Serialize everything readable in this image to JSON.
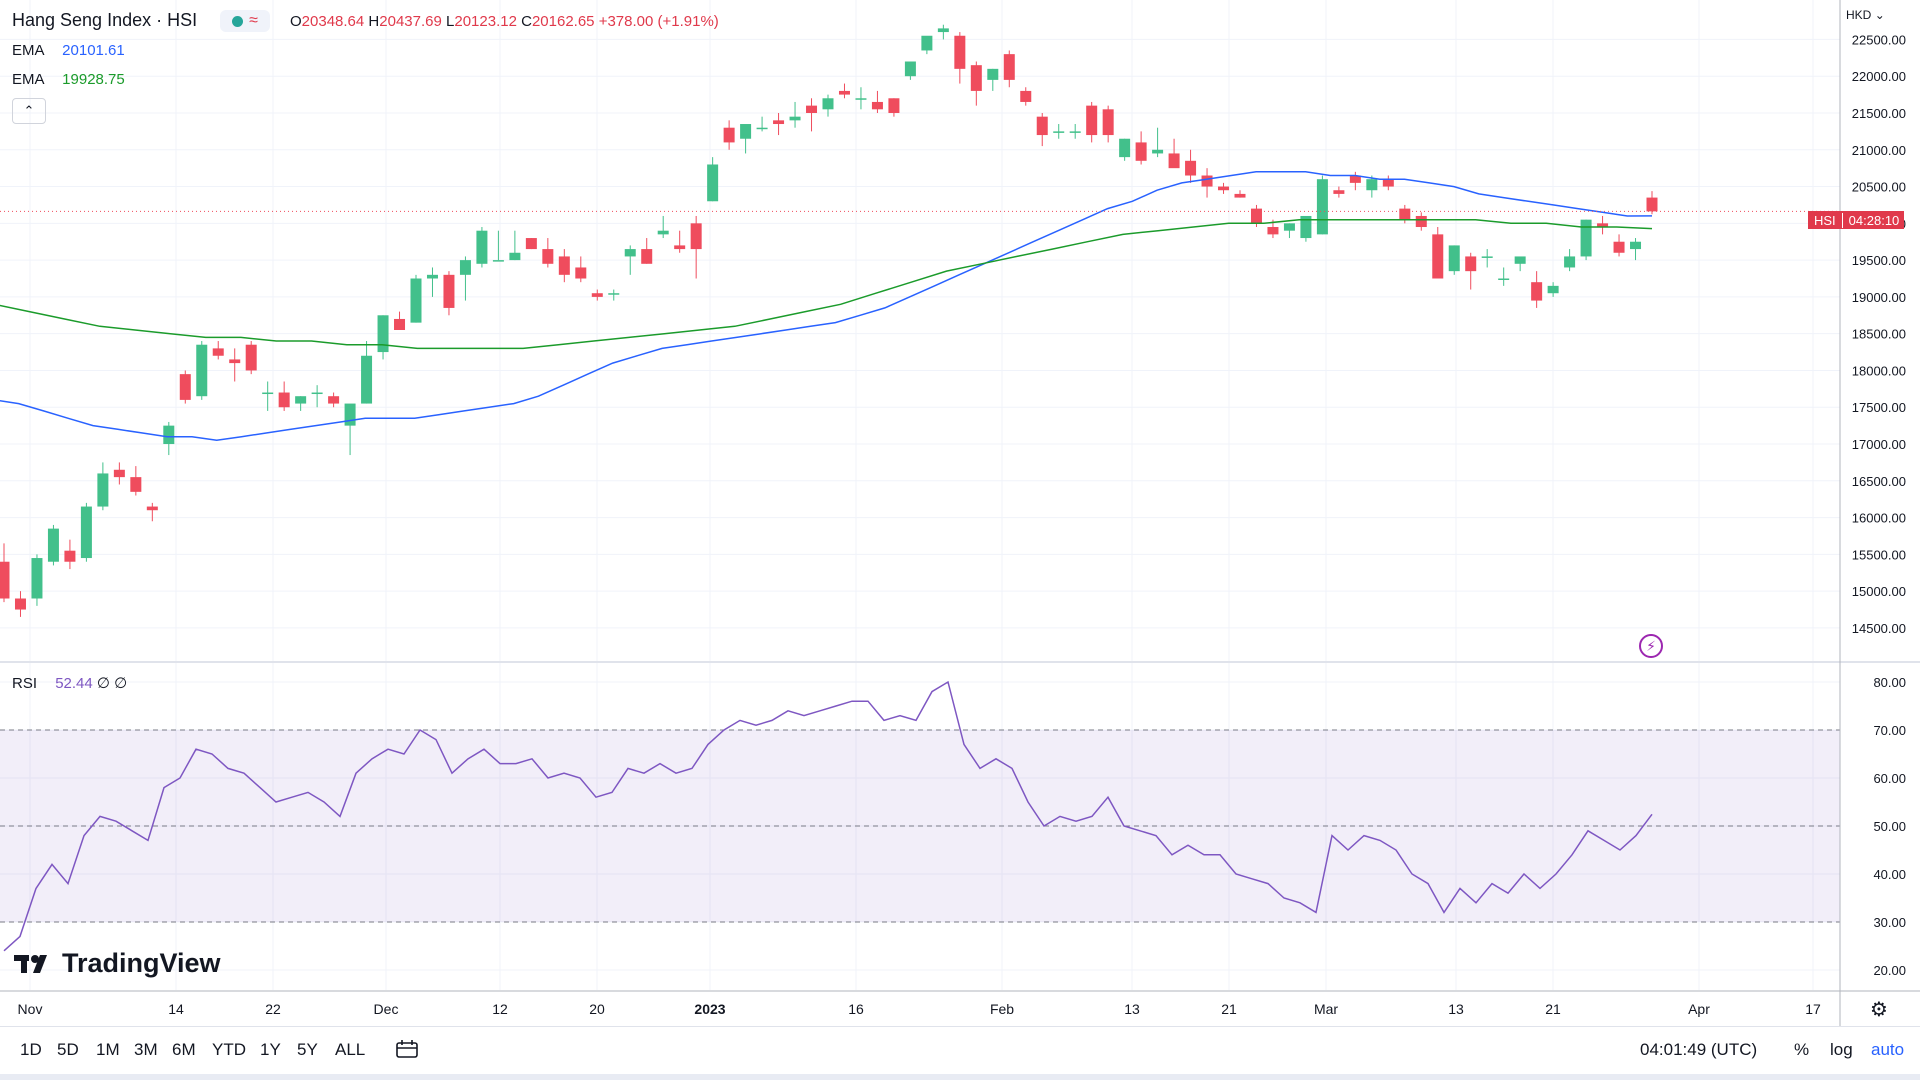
{
  "header": {
    "title": "Hang Seng Index · HSI",
    "ohlc": {
      "o_label": "O",
      "o": "20348.64",
      "h_label": "H",
      "h": "20437.69",
      "l_label": "L",
      "l": "20123.12",
      "c_label": "C",
      "c": "20162.65",
      "change": "+378.00 (+1.91%)"
    }
  },
  "indicators": {
    "ema1": {
      "label": "EMA",
      "value": "20101.61",
      "color": "#2962ff"
    },
    "ema2": {
      "label": "EMA",
      "value": "19928.75",
      "color": "#1b9b2b"
    },
    "rsi": {
      "label": "RSI",
      "value": "52.44",
      "extra": "∅ ∅",
      "color": "#7e57c2"
    }
  },
  "brand": {
    "name": "TradingView"
  },
  "price_axis": {
    "currency": "HKD",
    "ticks": [
      "22500.00",
      "22000.00",
      "21500.00",
      "21000.00",
      "20500.00",
      "20000.00",
      "19500.00",
      "19000.00",
      "18500.00",
      "18000.00",
      "17500.00",
      "17000.00",
      "16500.00",
      "16000.00",
      "15500.00",
      "15000.00",
      "14500.00"
    ],
    "last_tag": {
      "symbol": "HSI",
      "countdown": "04:28:10"
    }
  },
  "rsi_axis": {
    "ticks": [
      "80.00",
      "70.00",
      "60.00",
      "50.00",
      "40.00",
      "30.00",
      "20.00"
    ]
  },
  "time_axis": {
    "labels": [
      "Nov",
      "14",
      "22",
      "Dec",
      "12",
      "20",
      "2023",
      "16",
      "Feb",
      "13",
      "21",
      "Mar",
      "13",
      "21",
      "Apr",
      "17"
    ]
  },
  "toolbar": {
    "ranges": [
      "1D",
      "5D",
      "1M",
      "3M",
      "6M",
      "YTD",
      "1Y",
      "5Y",
      "ALL"
    ],
    "clock": "04:01:49 (UTC)",
    "percent": "%",
    "log": "log",
    "auto": "auto"
  },
  "colors": {
    "up": "#26a69a",
    "down": "#e0394b",
    "up_candle": "#42c08b",
    "down_candle": "#ef4c5d"
  },
  "chart_data": [
    {
      "type": "candlestick",
      "title": "Hang Seng Index · HSI",
      "ylim": [
        14200,
        22900
      ],
      "x_labels": [
        "Nov",
        "14",
        "22",
        "Dec",
        "12",
        "20",
        "2023",
        "16",
        "Feb",
        "13",
        "21",
        "Mar",
        "13",
        "21",
        "Apr",
        "17"
      ],
      "candles": [
        [
          15400,
          15650,
          14850,
          14900
        ],
        [
          14900,
          15000,
          14650,
          14750
        ],
        [
          14900,
          15500,
          14800,
          15450
        ],
        [
          15400,
          15900,
          15350,
          15850
        ],
        [
          15550,
          15700,
          15300,
          15400
        ],
        [
          15450,
          16200,
          15400,
          16150
        ],
        [
          16150,
          16750,
          16100,
          16600
        ],
        [
          16650,
          16750,
          16450,
          16550
        ],
        [
          16550,
          16700,
          16300,
          16350
        ],
        [
          16150,
          16200,
          15950,
          16100
        ],
        [
          17000,
          17300,
          16850,
          17250
        ],
        [
          17950,
          18000,
          17550,
          17600
        ],
        [
          17650,
          18400,
          17600,
          18350
        ],
        [
          18300,
          18400,
          18150,
          18200
        ],
        [
          18150,
          18300,
          17850,
          18100
        ],
        [
          18350,
          18400,
          17950,
          18000
        ],
        [
          17700,
          17850,
          17450,
          17700
        ],
        [
          17700,
          17850,
          17450,
          17500
        ],
        [
          17550,
          17650,
          17450,
          17650
        ],
        [
          17700,
          17800,
          17500,
          17700
        ],
        [
          17650,
          17700,
          17500,
          17550
        ],
        [
          17250,
          17350,
          16850,
          17550
        ],
        [
          17550,
          18400,
          17550,
          18200
        ],
        [
          18250,
          18750,
          18150,
          18750
        ],
        [
          18700,
          18800,
          18600,
          18550
        ],
        [
          18650,
          19300,
          18650,
          19250
        ],
        [
          19250,
          19400,
          19000,
          19300
        ],
        [
          19300,
          19350,
          18750,
          18850
        ],
        [
          19300,
          19550,
          18950,
          19500
        ],
        [
          19450,
          19950,
          19400,
          19900
        ],
        [
          19500,
          19900,
          19500,
          19500
        ],
        [
          19500,
          19900,
          19500,
          19600
        ],
        [
          19800,
          19800,
          19650,
          19650
        ],
        [
          19650,
          19800,
          19400,
          19450
        ],
        [
          19550,
          19650,
          19200,
          19300
        ],
        [
          19400,
          19550,
          19200,
          19250
        ],
        [
          19050,
          19100,
          18950,
          19000
        ],
        [
          19050,
          19100,
          18950,
          19050
        ],
        [
          19550,
          19700,
          19300,
          19650
        ],
        [
          19650,
          19800,
          19450,
          19450
        ],
        [
          19850,
          20100,
          19800,
          19900
        ],
        [
          19700,
          19900,
          19600,
          19650
        ],
        [
          20000,
          20100,
          19250,
          19650
        ],
        [
          20300,
          20900,
          20300,
          20800
        ],
        [
          21300,
          21400,
          21000,
          21100
        ],
        [
          21150,
          21300,
          20950,
          21350
        ],
        [
          21300,
          21450,
          21250,
          21300
        ],
        [
          21400,
          21500,
          21200,
          21350
        ],
        [
          21400,
          21650,
          21300,
          21450
        ],
        [
          21600,
          21700,
          21250,
          21500
        ],
        [
          21550,
          21750,
          21450,
          21700
        ],
        [
          21800,
          21900,
          21700,
          21750
        ],
        [
          21700,
          21850,
          21550,
          21700
        ],
        [
          21650,
          21800,
          21500,
          21550
        ],
        [
          21700,
          21700,
          21450,
          21500
        ],
        [
          22000,
          22100,
          21950,
          22200
        ],
        [
          22350,
          22500,
          22300,
          22550
        ],
        [
          22600,
          22700,
          22500,
          22650
        ],
        [
          22550,
          22600,
          21900,
          22100
        ],
        [
          22150,
          22200,
          21600,
          21800
        ],
        [
          21950,
          22100,
          21800,
          22100
        ],
        [
          22300,
          22350,
          21850,
          21950
        ],
        [
          21800,
          21850,
          21600,
          21650
        ],
        [
          21450,
          21500,
          21050,
          21200
        ],
        [
          21250,
          21350,
          21150,
          21250
        ],
        [
          21250,
          21350,
          21150,
          21250
        ],
        [
          21600,
          21650,
          21100,
          21200
        ],
        [
          21550,
          21600,
          21100,
          21200
        ],
        [
          20900,
          21150,
          20850,
          21150
        ],
        [
          21100,
          21250,
          20800,
          20850
        ],
        [
          20950,
          21300,
          20900,
          21000
        ],
        [
          20950,
          21150,
          20800,
          20750
        ],
        [
          20850,
          21000,
          20550,
          20650
        ],
        [
          20650,
          20750,
          20350,
          20500
        ],
        [
          20500,
          20550,
          20400,
          20450
        ],
        [
          20400,
          20450,
          20350,
          20350
        ],
        [
          20200,
          20250,
          19950,
          20000
        ],
        [
          19950,
          20050,
          19800,
          19850
        ],
        [
          19900,
          20000,
          19800,
          20000
        ],
        [
          19800,
          20050,
          19750,
          20100
        ],
        [
          19850,
          20650,
          19850,
          20600
        ],
        [
          20450,
          20500,
          20350,
          20400
        ],
        [
          20650,
          20700,
          20450,
          20550
        ],
        [
          20450,
          20650,
          20350,
          20600
        ],
        [
          20600,
          20650,
          20450,
          20500
        ],
        [
          20200,
          20250,
          20000,
          20050
        ],
        [
          20100,
          20150,
          19900,
          19950
        ],
        [
          19850,
          19950,
          19250,
          19250
        ],
        [
          19350,
          19700,
          19300,
          19700
        ],
        [
          19550,
          19600,
          19100,
          19350
        ],
        [
          19550,
          19650,
          19400,
          19550
        ],
        [
          19250,
          19400,
          19150,
          19250
        ],
        [
          19450,
          19500,
          19350,
          19550
        ],
        [
          19200,
          19350,
          18850,
          18950
        ],
        [
          19050,
          19200,
          19000,
          19150
        ],
        [
          19400,
          19650,
          19350,
          19550
        ],
        [
          19550,
          20050,
          19500,
          20050
        ],
        [
          20000,
          20100,
          19850,
          19950
        ],
        [
          19750,
          19850,
          19550,
          19600
        ],
        [
          19650,
          19800,
          19500,
          19750
        ],
        [
          20350,
          20437.69,
          20123.12,
          20162.65
        ]
      ],
      "series": [
        {
          "name": "EMA",
          "color": "#2962ff",
          "values": [
            17600,
            17550,
            17450,
            17350,
            17250,
            17200,
            17150,
            17100,
            17100,
            17050,
            17100,
            17150,
            17200,
            17250,
            17300,
            17350,
            17350,
            17350,
            17400,
            17450,
            17500,
            17550,
            17650,
            17800,
            17950,
            18100,
            18200,
            18300,
            18350,
            18400,
            18450,
            18500,
            18550,
            18600,
            18650,
            18750,
            18850,
            19000,
            19150,
            19300,
            19450,
            19600,
            19750,
            19900,
            20050,
            20200,
            20300,
            20450,
            20550,
            20600,
            20650,
            20700,
            20700,
            20700,
            20650,
            20650,
            20600,
            20600,
            20550,
            20500,
            20400,
            20350,
            20300,
            20250,
            20200,
            20150,
            20100,
            20101.61
          ]
        },
        {
          "name": "EMA",
          "color": "#1b9b2b",
          "values": [
            18900,
            18800,
            18700,
            18600,
            18550,
            18500,
            18450,
            18450,
            18400,
            18400,
            18350,
            18350,
            18300,
            18300,
            18300,
            18300,
            18350,
            18400,
            18450,
            18500,
            18550,
            18600,
            18700,
            18800,
            18900,
            19050,
            19200,
            19350,
            19450,
            19550,
            19650,
            19750,
            19850,
            19900,
            19950,
            20000,
            20000,
            20050,
            20050,
            20050,
            20050,
            20050,
            20050,
            20000,
            20000,
            19950,
            19950,
            19928.75
          ]
        }
      ]
    },
    {
      "type": "line",
      "title": "RSI",
      "ylim": [
        20,
        80
      ],
      "bands": [
        30,
        70
      ],
      "midline": 50,
      "series": [
        {
          "name": "RSI",
          "color": "#7e57c2",
          "values": [
            24,
            27,
            37,
            42,
            38,
            48,
            52,
            51,
            49,
            47,
            58,
            60,
            66,
            65,
            62,
            61,
            58,
            55,
            56,
            57,
            55,
            52,
            61,
            64,
            66,
            65,
            70,
            68,
            61,
            64,
            66,
            63,
            63,
            64,
            60,
            61,
            60,
            56,
            57,
            62,
            61,
            63,
            61,
            62,
            67,
            70,
            72,
            71,
            72,
            74,
            73,
            74,
            75,
            76,
            76,
            72,
            73,
            72,
            78,
            80,
            67,
            62,
            64,
            62,
            55,
            50,
            52,
            51,
            52,
            56,
            50,
            49,
            48,
            44,
            46,
            44,
            44,
            40,
            39,
            38,
            35,
            34,
            32,
            48,
            45,
            48,
            47,
            45,
            40,
            38,
            32,
            37,
            34,
            38,
            36,
            40,
            37,
            40,
            44,
            49,
            47,
            45,
            48,
            52.44
          ]
        }
      ]
    }
  ]
}
